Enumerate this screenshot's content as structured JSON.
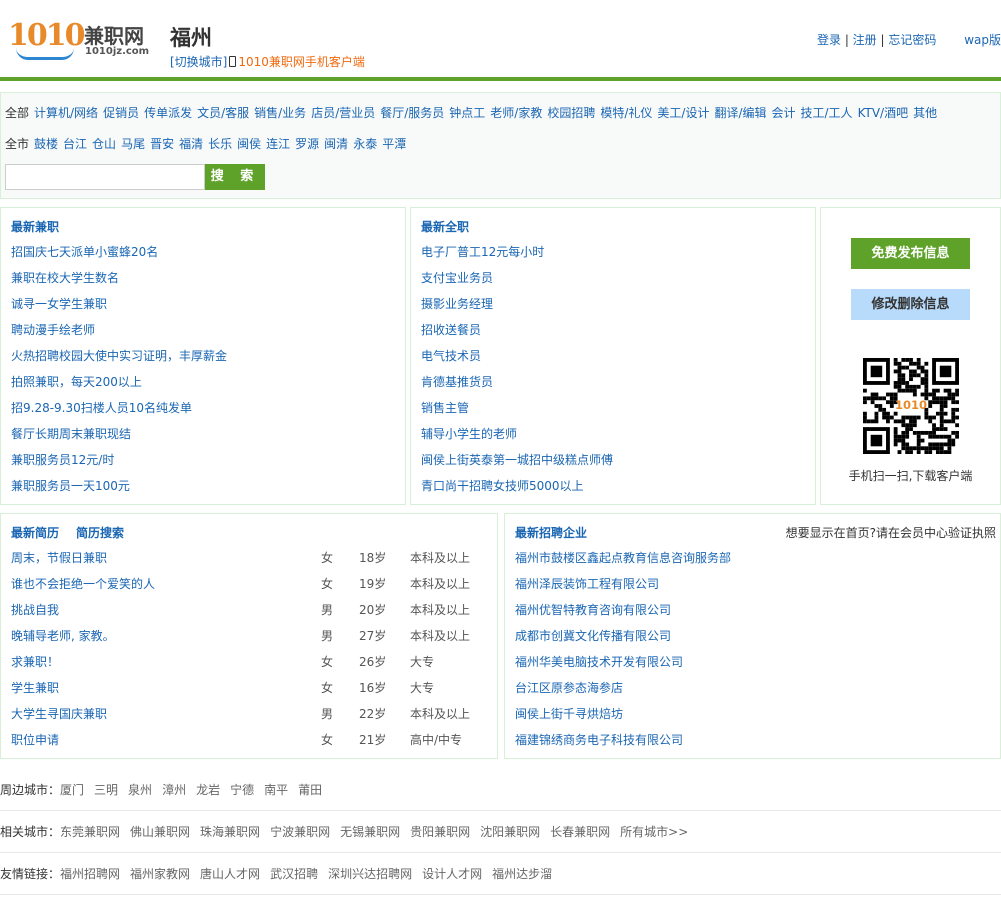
{
  "header": {
    "logo_text": "1010兼职网",
    "logo_num": "1010",
    "logo_cn": "兼职网",
    "logo_domain": "1010jz.com",
    "city": "福州",
    "switch_city": "[切换城市]",
    "app_link": "1010兼职网手机客户端",
    "login": "登录",
    "register": "注册",
    "forgot": "忘记密码",
    "wap": "wap版",
    "sep": " | "
  },
  "filter": {
    "category_label": "全部",
    "categories": [
      "计算机/网络",
      "促销员",
      "传单派发",
      "文员/客服",
      "销售/业务",
      "店员/营业员",
      "餐厅/服务员",
      "钟点工",
      "老师/家教",
      "校园招聘",
      "模特/礼仪",
      "美工/设计",
      "翻译/编辑",
      "会计",
      "技工/工人",
      "KTV/酒吧",
      "其他"
    ],
    "district_label": "全市",
    "districts": [
      "鼓楼",
      "台江",
      "仓山",
      "马尾",
      "晋安",
      "福清",
      "长乐",
      "闽侯",
      "连江",
      "罗源",
      "闽清",
      "永泰",
      "平潭"
    ],
    "search_placeholder": "",
    "search_button": "搜 索"
  },
  "latest_jobs": {
    "title": "最新兼职",
    "items": [
      "招国庆七天派单小蜜蜂20名",
      "兼职在校大学生数名",
      "诚寻一女学生兼职",
      "聘动漫手绘老师",
      "火热招聘校园大使中实习证明，丰厚薪金",
      "拍照兼职，每天200以上",
      "招9.28-9.30扫楼人员10名纯发单",
      "餐厅长期周末兼职现结",
      "兼职服务员12元/时",
      "兼职服务员一天100元"
    ]
  },
  "latest_fulltime": {
    "title": "最新全职",
    "items": [
      "电子厂普工12元每小时",
      "支付宝业务员",
      "摄影业务经理",
      "招收送餐员",
      "电气技术员",
      "肯德基推货员",
      "销售主管",
      "辅导小学生的老师",
      "闽侯上街英泰第一城招中级糕点师傅",
      "青口尚干招聘女技师5000以上"
    ]
  },
  "side": {
    "publish": "免费发布信息",
    "edit": "修改删除信息",
    "qr_logo": "1010",
    "qr_caption": "手机扫一扫,下载客户端"
  },
  "resumes": {
    "title": "最新简历",
    "search": "简历搜索",
    "rows": [
      {
        "title": "周末，节假日兼职",
        "gender": "女",
        "age": "18岁",
        "edu": "本科及以上"
      },
      {
        "title": "谁也不会拒绝一个爱笑的人",
        "gender": "女",
        "age": "19岁",
        "edu": "本科及以上"
      },
      {
        "title": "挑战自我",
        "gender": "男",
        "age": "20岁",
        "edu": "本科及以上"
      },
      {
        "title": "晚辅导老师, 家教。",
        "gender": "男",
        "age": "27岁",
        "edu": "本科及以上"
      },
      {
        "title": "求兼职！",
        "gender": "女",
        "age": "26岁",
        "edu": "大专"
      },
      {
        "title": "学生兼职",
        "gender": "女",
        "age": "16岁",
        "edu": "大专"
      },
      {
        "title": "大学生寻国庆兼职",
        "gender": "男",
        "age": "22岁",
        "edu": "本科及以上"
      },
      {
        "title": "职位申请",
        "gender": "女",
        "age": "21岁",
        "edu": "高中/中专"
      }
    ]
  },
  "companies": {
    "title": "最新招聘企业",
    "note": "想要显示在首页?请在会员中心验证执照",
    "items": [
      "福州市鼓楼区鑫起点教育信息咨询服务部",
      "福州泽辰装饰工程有限公司",
      "福州优智特教育咨询有限公司",
      "成都市创冀文化传播有限公司",
      "福州华美电脑技术开发有限公司",
      "台江区原参态海参店",
      "闽侯上街千寻烘焙坊",
      "福建锦绣商务电子科技有限公司"
    ]
  },
  "footer": {
    "nearby_label": "周边城市：",
    "nearby": [
      "厦门",
      "三明",
      "泉州",
      "漳州",
      "龙岩",
      "宁德",
      "南平",
      "莆田"
    ],
    "related_label": "相关城市：",
    "related": [
      "东莞兼职网",
      "佛山兼职网",
      "珠海兼职网",
      "宁波兼职网",
      "无锡兼职网",
      "贵阳兼职网",
      "沈阳兼职网",
      "长春兼职网",
      "所有城市>>"
    ],
    "friends_label": "友情链接：",
    "friends": [
      "福州招聘网",
      "福州家教网",
      "唐山人才网",
      "武汉招聘",
      "深圳兴达招聘网",
      "设计人才网",
      "福州达步溜"
    ]
  },
  "colors": {
    "green": "#5fa22a",
    "link": "#1a66b3",
    "orange": "#f06a0f",
    "light_blue": "#b9dbfb"
  }
}
